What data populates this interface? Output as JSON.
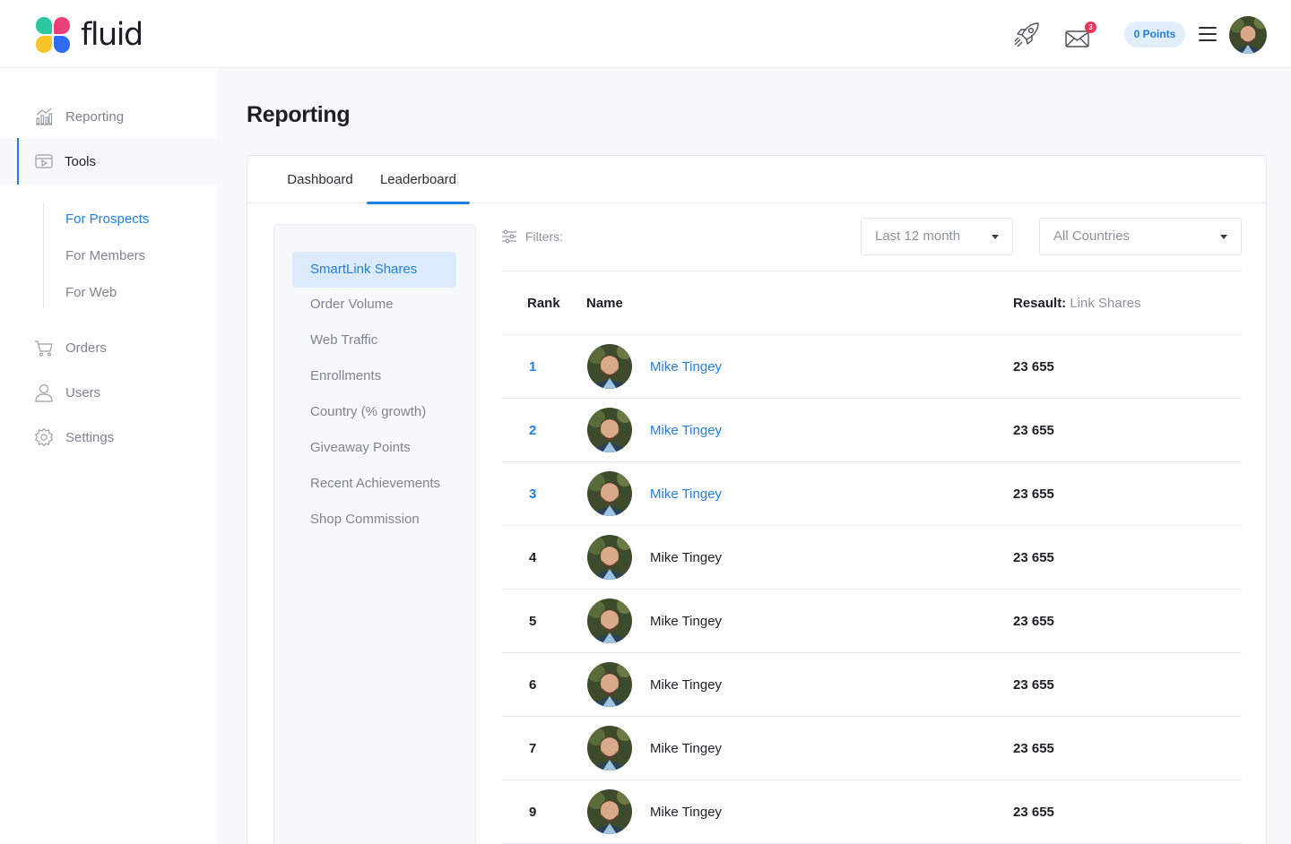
{
  "brand": {
    "name": "fluid"
  },
  "header": {
    "points_label": "0 Points",
    "mail_badge": "3",
    "icons": [
      "rocket-icon",
      "mail-icon",
      "menu-icon"
    ]
  },
  "sidebar": {
    "items": [
      {
        "label": "Reporting",
        "icon": "chart-icon"
      },
      {
        "label": "Tools",
        "icon": "tools-icon"
      },
      {
        "label": "Orders",
        "icon": "cart-icon"
      },
      {
        "label": "Users",
        "icon": "user-icon"
      },
      {
        "label": "Settings",
        "icon": "gear-icon"
      }
    ],
    "sub_items": [
      {
        "label": "For Prospects"
      },
      {
        "label": "For Members"
      },
      {
        "label": "For Web"
      }
    ]
  },
  "page": {
    "title": "Reporting"
  },
  "tabs": [
    {
      "label": "Dashboard"
    },
    {
      "label": "Leaderboard"
    }
  ],
  "metrics": [
    {
      "label": "SmartLink Shares"
    },
    {
      "label": "Order Volume"
    },
    {
      "label": "Web Traffic"
    },
    {
      "label": "Enrollments"
    },
    {
      "label": "Country (% growth)"
    },
    {
      "label": "Giveaway Points"
    },
    {
      "label": "Recent Achievements"
    },
    {
      "label": "Shop Commission"
    }
  ],
  "filters": {
    "label": "Filters:",
    "period": "Last 12 month",
    "country": "All Countries"
  },
  "table": {
    "col_rank": "Rank",
    "col_name": "Name",
    "col_result": "Resault:",
    "col_result_metric": "Link Shares",
    "rows": [
      {
        "rank": "1",
        "name": "Mike Tingey",
        "value": "23 655"
      },
      {
        "rank": "2",
        "name": "Mike Tingey",
        "value": "23 655"
      },
      {
        "rank": "3",
        "name": "Mike Tingey",
        "value": "23 655"
      },
      {
        "rank": "4",
        "name": "Mike Tingey",
        "value": "23 655"
      },
      {
        "rank": "5",
        "name": "Mike Tingey",
        "value": "23 655"
      },
      {
        "rank": "6",
        "name": "Mike Tingey",
        "value": "23 655"
      },
      {
        "rank": "7",
        "name": "Mike Tingey",
        "value": "23 655"
      },
      {
        "rank": "9",
        "name": "Mike Tingey",
        "value": "23 655"
      }
    ]
  },
  "colors": {
    "accent": "#1f7fe6",
    "active_bg": "#dcebfb"
  }
}
